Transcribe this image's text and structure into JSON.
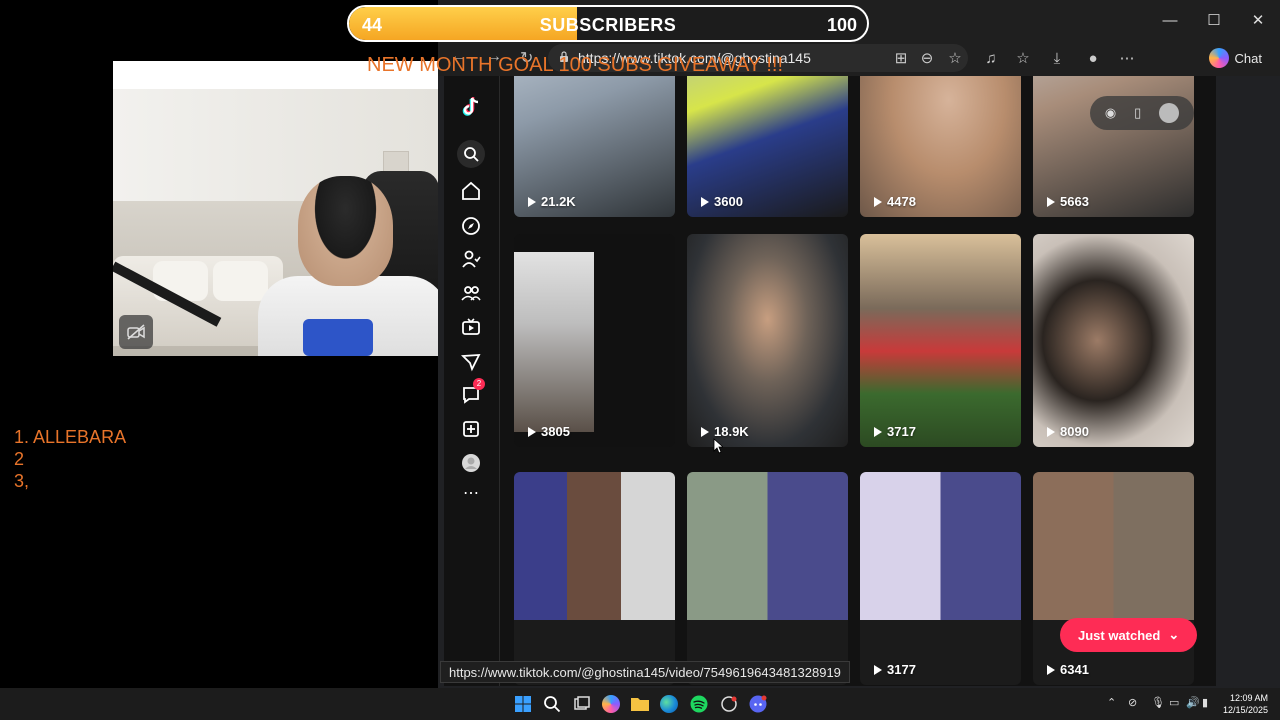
{
  "overlay": {
    "goal": {
      "current": "44",
      "label": "SUBSCRIBERS",
      "target": "100",
      "fill_fraction": 0.44
    },
    "goal_subtitle": "NEW MONTH GOAL 100 SUBS GIVEAWAY !!!",
    "ranking": [
      "1.  ALLEBARA",
      "2",
      "3,"
    ]
  },
  "browser": {
    "url": "https://www.tiktok.com/@ghostina145",
    "chat_label": "Chat",
    "status_url": "https://www.tiktok.com/@ghostina145/video/7549619643481328919"
  },
  "sidebar": {
    "icons": [
      "tiktok-logo-icon",
      "search-icon",
      "home-icon",
      "explore-icon",
      "following-icon",
      "friends-icon",
      "live-icon",
      "messages-icon",
      "inbox-icon",
      "upload-icon",
      "profile-icon",
      "more-icon"
    ],
    "inbox_badge": "2"
  },
  "videos": [
    {
      "views": "21.2K"
    },
    {
      "views": "3600"
    },
    {
      "views": "4478"
    },
    {
      "views": "5663"
    },
    {
      "views": "3805"
    },
    {
      "views": "18.9K"
    },
    {
      "views": "3717"
    },
    {
      "views": "8090"
    },
    {
      "views": ""
    },
    {
      "views": ""
    },
    {
      "views": "3177"
    },
    {
      "views": "6341"
    }
  ],
  "just_watched": "Just watched",
  "taskbar": {
    "time": "12:09 AM",
    "date": "12/15/2025"
  },
  "colors": {
    "accent": "#fe2c55",
    "overlay_text": "#e8742a",
    "goal_fill": "#f5a623"
  }
}
